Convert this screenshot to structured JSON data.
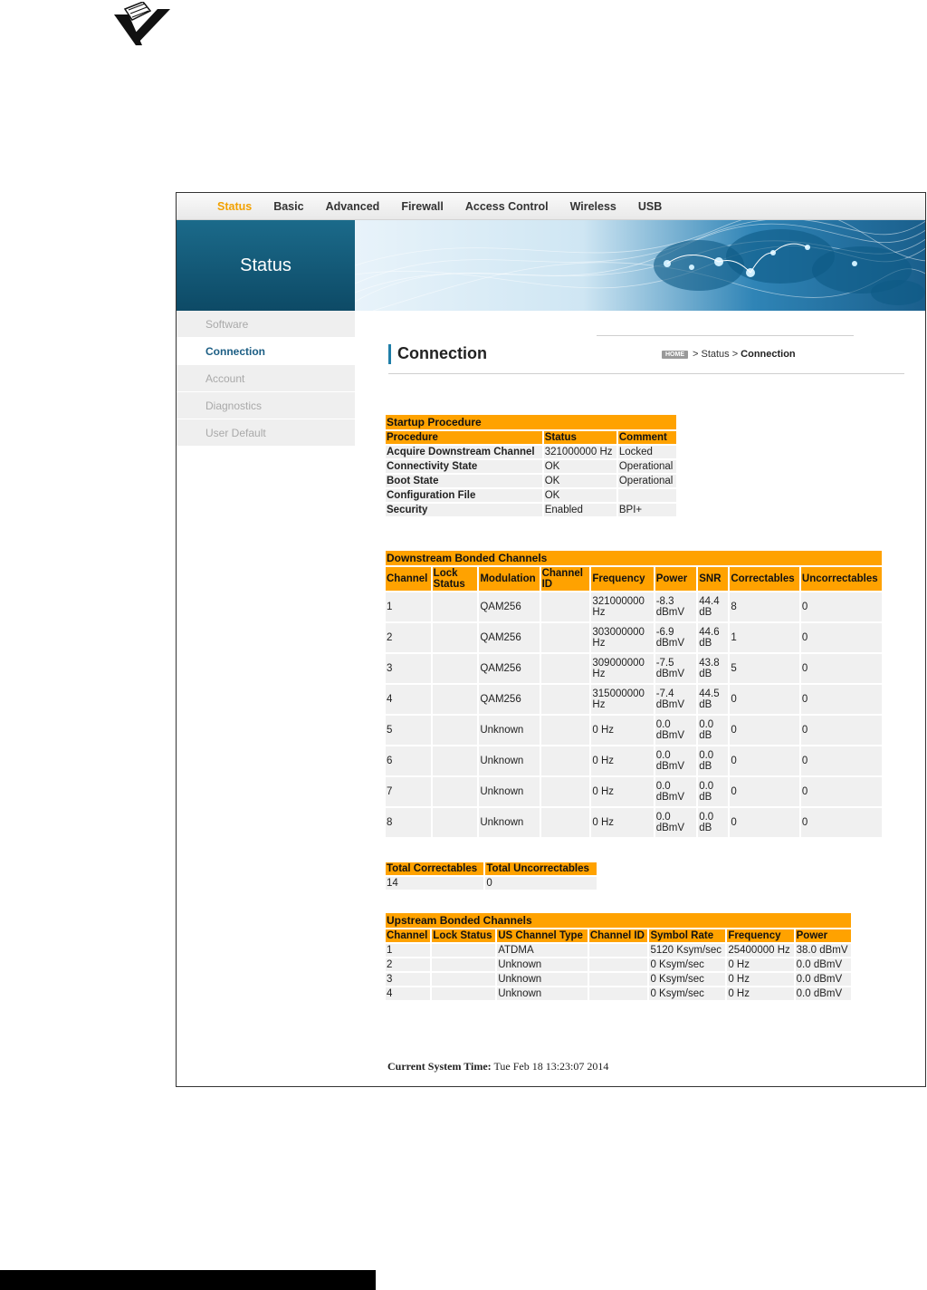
{
  "nav": [
    "Status",
    "Basic",
    "Advanced",
    "Firewall",
    "Access Control",
    "Wireless",
    "USB"
  ],
  "banner": {
    "title": "Status"
  },
  "sidebar": [
    "Software",
    "Connection",
    "Account",
    "Diagnostics",
    "User Default"
  ],
  "page": {
    "title": "Connection",
    "breadcrumb": {
      "home": "HOME",
      "sep1": "> Status >",
      "current": "Connection"
    }
  },
  "startup": {
    "title": "Startup Procedure",
    "headers": [
      "Procedure",
      "Status",
      "Comment"
    ],
    "rows": [
      [
        "Acquire Downstream Channel",
        "321000000 Hz",
        "Locked"
      ],
      [
        "Connectivity State",
        "OK",
        "Operational"
      ],
      [
        "Boot State",
        "OK",
        "Operational"
      ],
      [
        "Configuration File",
        "OK",
        ""
      ],
      [
        "Security",
        "Enabled",
        "BPI+"
      ]
    ]
  },
  "downstream": {
    "title": "Downstream Bonded Channels",
    "headers": [
      "Channel",
      "Lock Status",
      "Modulation",
      "Channel ID",
      "Frequency",
      "Power",
      "SNR",
      "Correctables",
      "Uncorrectables"
    ],
    "rows": [
      [
        "1",
        "",
        "QAM256",
        "",
        "321000000 Hz",
        "-8.3 dBmV",
        "44.4 dB",
        "8",
        "0"
      ],
      [
        "2",
        "",
        "QAM256",
        "",
        "303000000 Hz",
        "-6.9 dBmV",
        "44.6 dB",
        "1",
        "0"
      ],
      [
        "3",
        "",
        "QAM256",
        "",
        "309000000 Hz",
        "-7.5 dBmV",
        "43.8 dB",
        "5",
        "0"
      ],
      [
        "4",
        "",
        "QAM256",
        "",
        "315000000 Hz",
        "-7.4 dBmV",
        "44.5 dB",
        "0",
        "0"
      ],
      [
        "5",
        "",
        "Unknown",
        "",
        "0 Hz",
        "0.0 dBmV",
        "0.0 dB",
        "0",
        "0"
      ],
      [
        "6",
        "",
        "Unknown",
        "",
        "0 Hz",
        "0.0 dBmV",
        "0.0 dB",
        "0",
        "0"
      ],
      [
        "7",
        "",
        "Unknown",
        "",
        "0 Hz",
        "0.0 dBmV",
        "0.0 dB",
        "0",
        "0"
      ],
      [
        "8",
        "",
        "Unknown",
        "",
        "0 Hz",
        "0.0 dBmV",
        "0.0 dB",
        "0",
        "0"
      ]
    ]
  },
  "totals": {
    "headers": [
      "Total Correctables",
      "Total Uncorrectables"
    ],
    "values": [
      "14",
      "0"
    ]
  },
  "upstream": {
    "title": "Upstream Bonded Channels",
    "headers": [
      "Channel",
      "Lock Status",
      "US Channel Type",
      "Channel ID",
      "Symbol Rate",
      "Frequency",
      "Power"
    ],
    "rows": [
      [
        "1",
        "",
        "ATDMA",
        "",
        "5120 Ksym/sec",
        "25400000 Hz",
        "38.0 dBmV"
      ],
      [
        "2",
        "",
        "Unknown",
        "",
        "0 Ksym/sec",
        "0 Hz",
        "0.0 dBmV"
      ],
      [
        "3",
        "",
        "Unknown",
        "",
        "0 Ksym/sec",
        "0 Hz",
        "0.0 dBmV"
      ],
      [
        "4",
        "",
        "Unknown",
        "",
        "0 Ksym/sec",
        "0 Hz",
        "0.0 dBmV"
      ]
    ]
  },
  "system_time": {
    "label": "Current System Time:",
    "value": "Tue Feb 18 13:23:07 2014"
  },
  "colors": {
    "accent": "#ffa200",
    "nav_active": "#f2a100",
    "brand_blue": "#0d4a66",
    "link": "#1c5e84"
  },
  "icons": {
    "logo": "pen-checkmark-icon",
    "home": "home-badge-icon"
  }
}
